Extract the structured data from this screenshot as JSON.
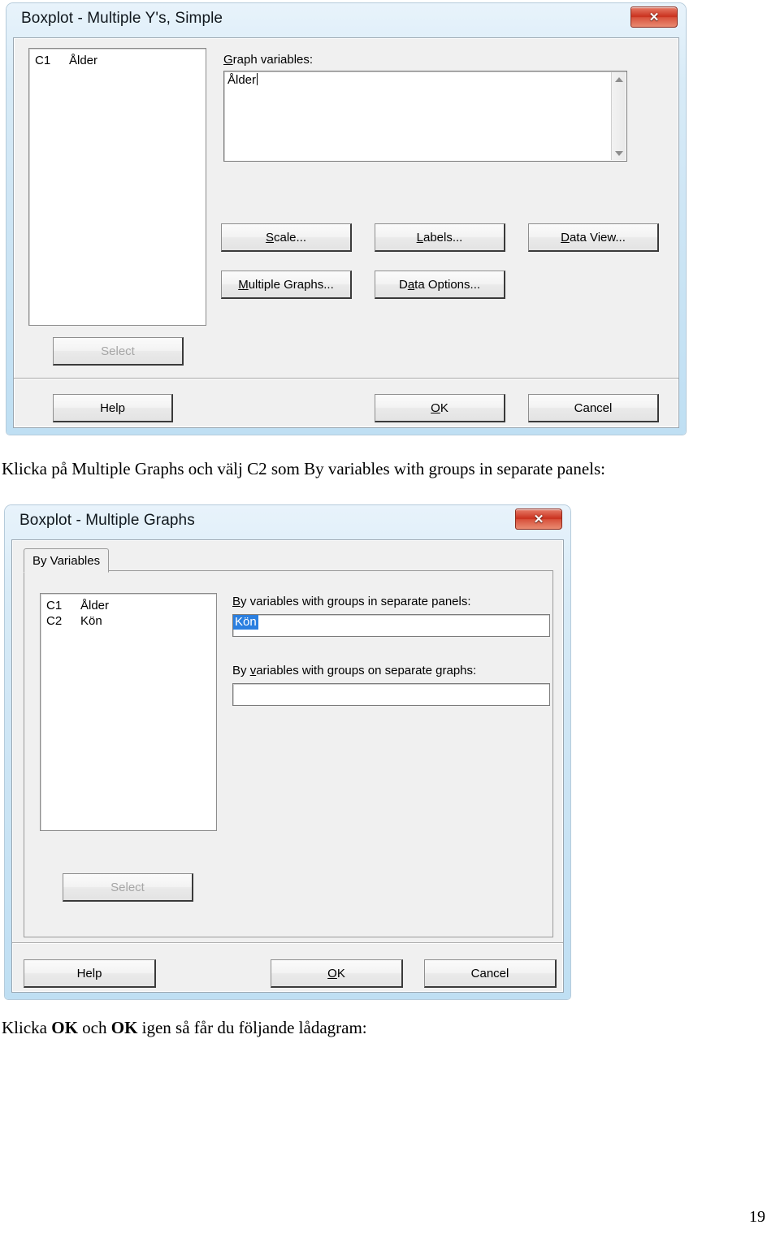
{
  "page": {
    "number": "19"
  },
  "captions": {
    "middle_pre": "Klicka på Multiple Graphs och välj C2 som By variables with groups in separate panels:",
    "bottom_pre": "Klicka ",
    "bottom_ok1": "OK",
    "bottom_mid": " och ",
    "bottom_ok2": "OK",
    "bottom_post": " igen så får du följande lådagram:"
  },
  "dialog1": {
    "title": "Boxplot - Multiple Y's, Simple",
    "close_glyph": "✕",
    "close_icon_name": "close-icon",
    "variables": [
      {
        "id": "C1",
        "name": "Ålder"
      }
    ],
    "graph_variables_label_mnemonic": "G",
    "graph_variables_label_rest": "raph variables:",
    "graph_variables_value": "Ålder",
    "buttons": {
      "scale": {
        "mn": "S",
        "rest": "cale..."
      },
      "labels": {
        "mn": "L",
        "rest": "abels..."
      },
      "data_view": {
        "mn": "D",
        "rest": "ata View..."
      },
      "multiple_graphs": {
        "mn": "M",
        "rest": "ultiple Graphs..."
      },
      "data_options_pre": "D",
      "data_options_mn": "a",
      "data_options_rest": "ta Options...",
      "select": "Select",
      "help": "Help",
      "ok_mn": "O",
      "ok_rest": "K",
      "cancel": "Cancel"
    }
  },
  "dialog2": {
    "title": "Boxplot - Multiple Graphs",
    "close_glyph": "✕",
    "close_icon_name": "close-icon",
    "tab": "By Variables",
    "variables": [
      {
        "id": "C1",
        "name": "Ålder"
      },
      {
        "id": "C2",
        "name": "Kön"
      }
    ],
    "panels_label_mn": "B",
    "panels_label_rest": "y variables with groups in separate panels:",
    "panels_value": "Kön",
    "graphs_label_pre": "By ",
    "graphs_label_mn": "v",
    "graphs_label_rest": "ariables with groups on separate graphs:",
    "graphs_value": "",
    "buttons": {
      "select": "Select",
      "help": "Help",
      "ok_mn": "O",
      "ok_rest": "K",
      "cancel": "Cancel"
    }
  }
}
